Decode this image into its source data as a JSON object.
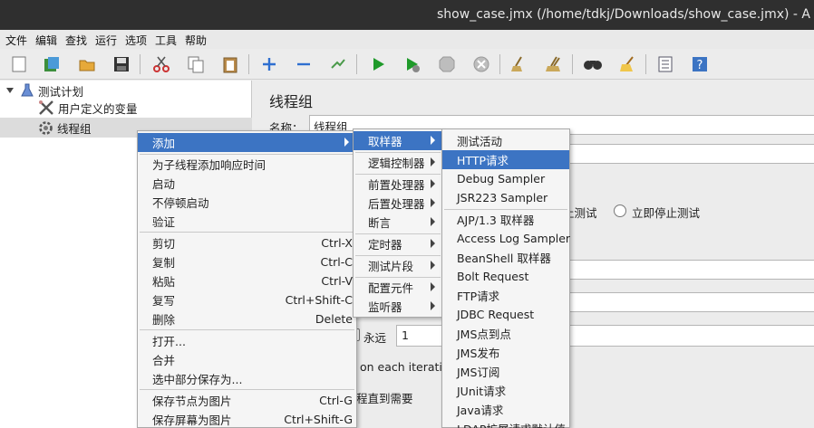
{
  "window": {
    "title": "show_case.jmx (/home/tdkj/Downloads/show_case.jmx) - A"
  },
  "menubar": [
    "文件",
    "编辑",
    "查找",
    "运行",
    "选项",
    "工具",
    "帮助"
  ],
  "toolbar_icons": [
    "new-icon",
    "templates-icon",
    "open-icon",
    "save-icon",
    "cut-icon",
    "copy-icon",
    "paste-icon",
    "expand-icon",
    "collapse-icon",
    "toggle-icon",
    "start-icon",
    "start-no-pause-icon",
    "stop-icon",
    "shutdown-icon",
    "clear-icon",
    "clear-all-icon",
    "search-icon",
    "reset-search-icon",
    "function-helper-icon",
    "help-icon"
  ],
  "tree": [
    {
      "label": "测试计划",
      "icon": "test-plan-icon"
    },
    {
      "label": "用户定义的变量",
      "icon": "tools-icon"
    },
    {
      "label": "线程组",
      "icon": "gear-icon"
    }
  ],
  "panel": {
    "title": "线程组",
    "name_label": "名称：",
    "name_value": "线程组",
    "radio_stop_test": "止测试",
    "radio_stop_test_now": "立即停止测试",
    "forever_label": "永远",
    "loop_value": "1",
    "each_iteration_text": "on each iteration",
    "delay_text": "程直到需要"
  },
  "context_menu": {
    "items": [
      {
        "label": "添加",
        "submenu": true
      },
      {
        "sep": true
      },
      {
        "label": "为子线程添加响应时间"
      },
      {
        "label": "启动"
      },
      {
        "label": "不停顿启动"
      },
      {
        "label": "验证"
      },
      {
        "sep": true
      },
      {
        "label": "剪切",
        "shortcut": "Ctrl-X"
      },
      {
        "label": "复制",
        "shortcut": "Ctrl-C"
      },
      {
        "label": "粘贴",
        "shortcut": "Ctrl-V"
      },
      {
        "label": "复写",
        "shortcut": "Ctrl+Shift-C"
      },
      {
        "label": "删除",
        "shortcut": "Delete"
      },
      {
        "sep": true
      },
      {
        "label": "打开..."
      },
      {
        "label": "合并"
      },
      {
        "label": "选中部分保存为..."
      },
      {
        "sep": true
      },
      {
        "label": "保存节点为图片",
        "shortcut": "Ctrl-G"
      },
      {
        "label": "保存屏幕为图片",
        "shortcut": "Ctrl+Shift-G"
      }
    ]
  },
  "add_submenu": {
    "items": [
      {
        "label": "取样器",
        "submenu": true
      },
      {
        "sep": true
      },
      {
        "label": "逻辑控制器",
        "submenu": true
      },
      {
        "sep": true
      },
      {
        "label": "前置处理器",
        "submenu": true
      },
      {
        "label": "后置处理器",
        "submenu": true
      },
      {
        "label": "断言",
        "submenu": true
      },
      {
        "sep": true
      },
      {
        "label": "定时器",
        "submenu": true
      },
      {
        "sep": true
      },
      {
        "label": "测试片段",
        "submenu": true
      },
      {
        "sep": true
      },
      {
        "label": "配置元件",
        "submenu": true
      },
      {
        "label": "监听器",
        "submenu": true
      }
    ]
  },
  "sampler_submenu": {
    "items": [
      {
        "label": "测试活动"
      },
      {
        "label": "HTTP请求"
      },
      {
        "label": "Debug Sampler"
      },
      {
        "label": "JSR223 Sampler"
      },
      {
        "sep": true
      },
      {
        "label": "AJP/1.3 取样器"
      },
      {
        "label": "Access Log Sampler"
      },
      {
        "label": "BeanShell 取样器"
      },
      {
        "label": "Bolt Request"
      },
      {
        "label": "FTP请求"
      },
      {
        "label": "JDBC Request"
      },
      {
        "label": "JMS点到点"
      },
      {
        "label": "JMS发布"
      },
      {
        "label": "JMS订阅"
      },
      {
        "label": "JUnit请求"
      },
      {
        "label": "Java请求"
      },
      {
        "label": "LDAP扩展请求默认值"
      }
    ]
  },
  "highlight": {
    "context_menu": 0,
    "add_submenu": 0,
    "sampler_submenu": 1
  },
  "colors": {
    "highlight": "#3c74c3",
    "titlebar": "#2f2f2f",
    "menu_bg": "#f5f5f5"
  }
}
